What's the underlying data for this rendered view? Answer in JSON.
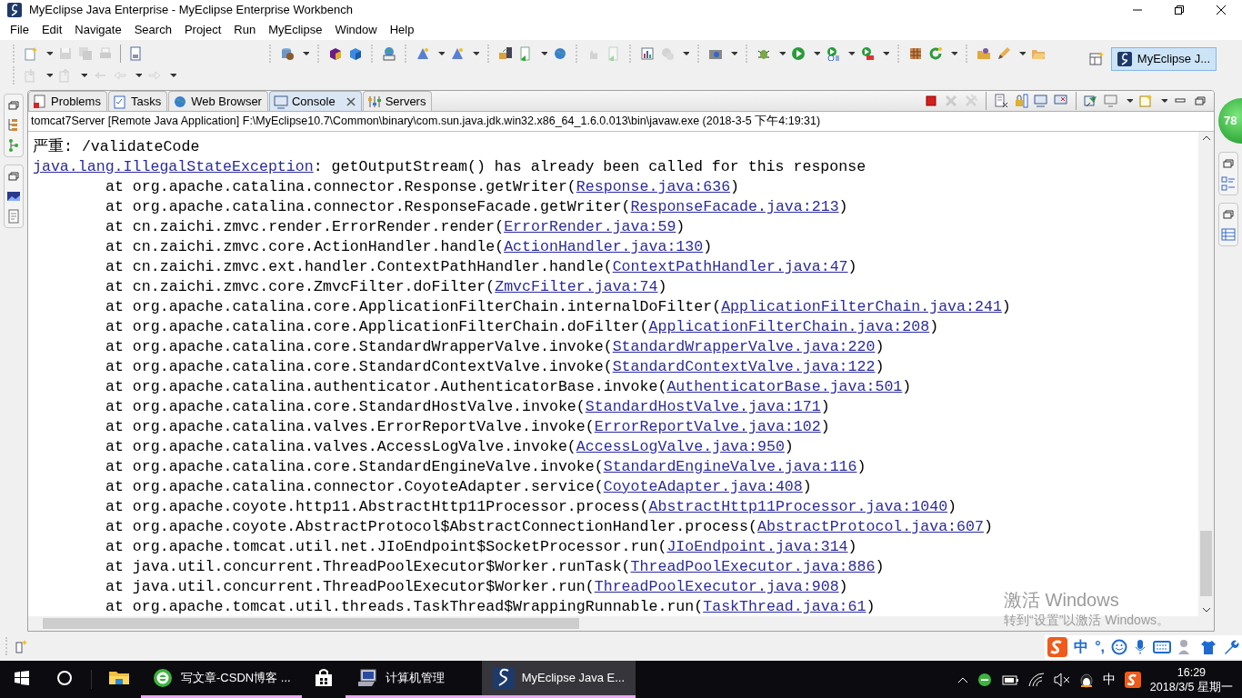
{
  "window": {
    "title": "MyEclipse Java Enterprise - MyEclipse Enterprise Workbench"
  },
  "menu": [
    "File",
    "Edit",
    "Navigate",
    "Search",
    "Project",
    "Run",
    "MyEclipse",
    "Window",
    "Help"
  ],
  "perspective": {
    "label": "MyEclipse J...",
    "selected": true
  },
  "view": {
    "tabs": [
      {
        "label": "Problems",
        "selected": false,
        "closable": false
      },
      {
        "label": "Tasks",
        "selected": false,
        "closable": false
      },
      {
        "label": "Web Browser",
        "selected": false,
        "closable": false
      },
      {
        "label": "Console",
        "selected": true,
        "closable": true
      },
      {
        "label": "Servers",
        "selected": false,
        "closable": false
      }
    ],
    "console_header": "tomcat7Server [Remote Java Application] F:\\MyEclipse10.7\\Common\\binary\\com.sun.java.jdk.win32.x86_64_1.6.0.013\\bin\\javaw.exe (2018-3-5 下午4:19:31)",
    "lines": [
      {
        "indented": false,
        "text": "严重: /validateCode"
      },
      {
        "indented": false,
        "link": "java.lang.IllegalStateException",
        "after": ": getOutputStream() has already been called for this response"
      },
      {
        "indented": true,
        "text": "at org.apache.catalina.connector.Response.getWriter(",
        "link": "Response.java:636",
        "after": ")"
      },
      {
        "indented": true,
        "text": "at org.apache.catalina.connector.ResponseFacade.getWriter(",
        "link": "ResponseFacade.java:213",
        "after": ")"
      },
      {
        "indented": true,
        "text": "at cn.zaichi.zmvc.render.ErrorRender.render(",
        "link": "ErrorRender.java:59",
        "after": ")"
      },
      {
        "indented": true,
        "text": "at cn.zaichi.zmvc.core.ActionHandler.handle(",
        "link": "ActionHandler.java:130",
        "after": ")"
      },
      {
        "indented": true,
        "text": "at cn.zaichi.zmvc.ext.handler.ContextPathHandler.handle(",
        "link": "ContextPathHandler.java:47",
        "after": ")"
      },
      {
        "indented": true,
        "text": "at cn.zaichi.zmvc.core.ZmvcFilter.doFilter(",
        "link": "ZmvcFilter.java:74",
        "after": ")"
      },
      {
        "indented": true,
        "text": "at org.apache.catalina.core.ApplicationFilterChain.internalDoFilter(",
        "link": "ApplicationFilterChain.java:241",
        "after": ")"
      },
      {
        "indented": true,
        "text": "at org.apache.catalina.core.ApplicationFilterChain.doFilter(",
        "link": "ApplicationFilterChain.java:208",
        "after": ")"
      },
      {
        "indented": true,
        "text": "at org.apache.catalina.core.StandardWrapperValve.invoke(",
        "link": "StandardWrapperValve.java:220",
        "after": ")"
      },
      {
        "indented": true,
        "text": "at org.apache.catalina.core.StandardContextValve.invoke(",
        "link": "StandardContextValve.java:122",
        "after": ")"
      },
      {
        "indented": true,
        "text": "at org.apache.catalina.authenticator.AuthenticatorBase.invoke(",
        "link": "AuthenticatorBase.java:501",
        "after": ")"
      },
      {
        "indented": true,
        "text": "at org.apache.catalina.core.StandardHostValve.invoke(",
        "link": "StandardHostValve.java:171",
        "after": ")"
      },
      {
        "indented": true,
        "text": "at org.apache.catalina.valves.ErrorReportValve.invoke(",
        "link": "ErrorReportValve.java:102",
        "after": ")"
      },
      {
        "indented": true,
        "text": "at org.apache.catalina.valves.AccessLogValve.invoke(",
        "link": "AccessLogValve.java:950",
        "after": ")"
      },
      {
        "indented": true,
        "text": "at org.apache.catalina.core.StandardEngineValve.invoke(",
        "link": "StandardEngineValve.java:116",
        "after": ")"
      },
      {
        "indented": true,
        "text": "at org.apache.catalina.connector.CoyoteAdapter.service(",
        "link": "CoyoteAdapter.java:408",
        "after": ")"
      },
      {
        "indented": true,
        "text": "at org.apache.coyote.http11.AbstractHttp11Processor.process(",
        "link": "AbstractHttp11Processor.java:1040",
        "after": ")"
      },
      {
        "indented": true,
        "text": "at org.apache.coyote.AbstractProtocol$AbstractConnectionHandler.process(",
        "link": "AbstractProtocol.java:607",
        "after": ")"
      },
      {
        "indented": true,
        "text": "at org.apache.tomcat.util.net.JIoEndpoint$SocketProcessor.run(",
        "link": "JIoEndpoint.java:314",
        "after": ")"
      },
      {
        "indented": true,
        "text": "at java.util.concurrent.ThreadPoolExecutor$Worker.runTask(",
        "link": "ThreadPoolExecutor.java:886",
        "after": ")"
      },
      {
        "indented": true,
        "text": "at java.util.concurrent.ThreadPoolExecutor$Worker.run(",
        "link": "ThreadPoolExecutor.java:908",
        "after": ")"
      },
      {
        "indented": true,
        "text": "at org.apache.tomcat.util.threads.TaskThread$WrappingRunnable.run(",
        "link": "TaskThread.java:61",
        "after": ")"
      }
    ]
  },
  "speed_ball": {
    "reading": "78"
  },
  "activation_notice": {
    "title": "激活 Windows",
    "subtitle": "转到“设置”以激活 Windows。"
  },
  "ime_bar": {
    "mode": "中",
    "punctuation": "°,"
  },
  "taskbar": {
    "items": [
      {
        "kind": "explorer",
        "running": false,
        "selected": false
      },
      {
        "kind": "browser",
        "label": "写文章-CSDN博客 ...",
        "running": true,
        "selected": false
      },
      {
        "kind": "store",
        "running": false,
        "selected": false
      },
      {
        "kind": "management",
        "label": "计算机管理",
        "running": true,
        "selected": false
      },
      {
        "kind": "myeclipse",
        "label": "MyEclipse Java E...",
        "running": true,
        "selected": true
      }
    ],
    "tray": {
      "ime": "中",
      "time": "16:29",
      "date": "2018/3/5 星期一"
    }
  }
}
